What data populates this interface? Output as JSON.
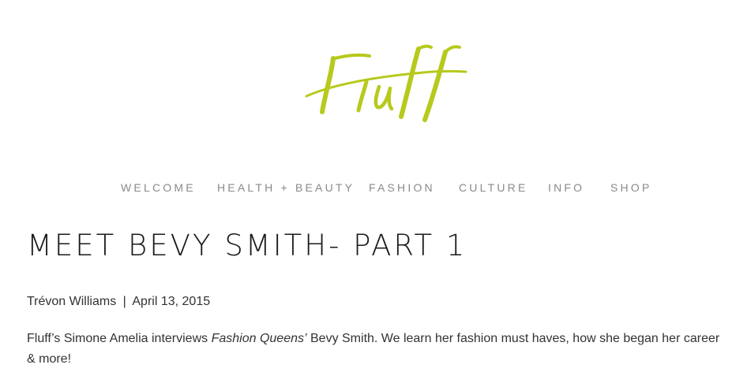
{
  "brand": {
    "logo_text": "Fluff",
    "logo_color": "#b7c91c"
  },
  "nav": {
    "items": [
      {
        "label": "WELCOME"
      },
      {
        "label": "HEALTH + BEAUTY"
      },
      {
        "label": "FASHION"
      },
      {
        "label": "CULTURE"
      },
      {
        "label": "INFO"
      },
      {
        "label": "SHOP"
      }
    ]
  },
  "post": {
    "title": "MEET BEVY SMITH- PART 1",
    "author": "Trévon Williams",
    "separator": "|",
    "date": "April 13, 2015",
    "excerpt_before": "Fluff’s Simone Amelia interviews ",
    "excerpt_italic": "Fashion Queens’",
    "excerpt_after": " Bevy Smith. We learn her fashion must haves, how she began her career & more!"
  },
  "colors": {
    "nav_text": "#8a8a8a",
    "title_text": "#1a1a1a",
    "body_text": "#333333"
  }
}
